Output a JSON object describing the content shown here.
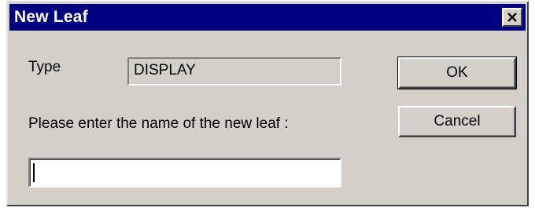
{
  "window": {
    "title": "New Leaf",
    "close_icon": "close-icon"
  },
  "form": {
    "type_label": "Type",
    "type_value": "DISPLAY",
    "prompt_label": "Please enter the name of the new leaf :",
    "name_value": "",
    "name_placeholder": ""
  },
  "buttons": {
    "ok_label": "OK",
    "cancel_label": "Cancel"
  },
  "colors": {
    "titlebar": "#000080",
    "dialog_face": "#d4d0c8",
    "input_background": "#ffffff"
  }
}
